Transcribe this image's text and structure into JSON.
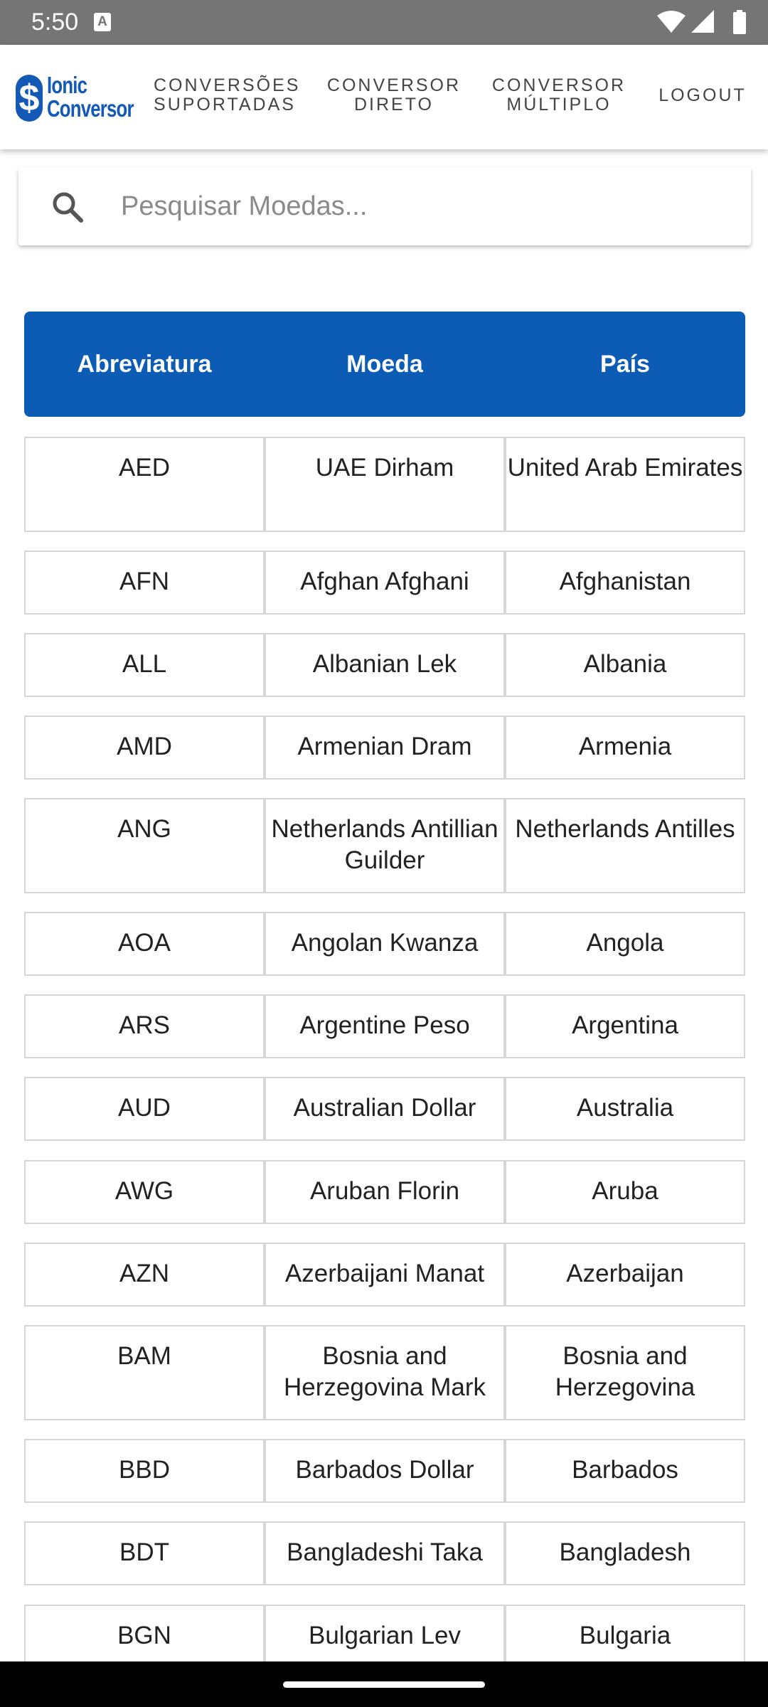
{
  "status": {
    "time": "5:50",
    "notif_letter": "A"
  },
  "logo": {
    "symbol": "$",
    "line1": "Ionic",
    "line2": "Conversor"
  },
  "nav": [
    {
      "line1": "CONVERSÕES",
      "line2": "SUPORTADAS"
    },
    {
      "line1": "CONVERSOR",
      "line2": "DIRETO"
    },
    {
      "line1": "CONVERSOR",
      "line2": "MÚLTIPLO"
    },
    {
      "line1": "LOGOUT",
      "line2": ""
    }
  ],
  "search": {
    "placeholder": "Pesquisar Moedas...",
    "value": ""
  },
  "table": {
    "headers": [
      "Abreviatura",
      "Moeda",
      "País"
    ],
    "rows": [
      {
        "abbr": "AED",
        "currency": "UAE Dirham",
        "country": "United Arab Emirates"
      },
      {
        "abbr": "AFN",
        "currency": "Afghan Afghani",
        "country": "Afghanistan"
      },
      {
        "abbr": "ALL",
        "currency": "Albanian Lek",
        "country": "Albania"
      },
      {
        "abbr": "AMD",
        "currency": "Armenian Dram",
        "country": "Armenia"
      },
      {
        "abbr": "ANG",
        "currency": "Netherlands Antillian Guilder",
        "country": "Netherlands Antilles"
      },
      {
        "abbr": "AOA",
        "currency": "Angolan Kwanza",
        "country": "Angola"
      },
      {
        "abbr": "ARS",
        "currency": "Argentine Peso",
        "country": "Argentina"
      },
      {
        "abbr": "AUD",
        "currency": "Australian Dollar",
        "country": "Australia"
      },
      {
        "abbr": "AWG",
        "currency": "Aruban Florin",
        "country": "Aruba"
      },
      {
        "abbr": "AZN",
        "currency": "Azerbaijani Manat",
        "country": "Azerbaijan"
      },
      {
        "abbr": "BAM",
        "currency": "Bosnia and Herzegovina Mark",
        "country": "Bosnia and Herzegovina"
      },
      {
        "abbr": "BBD",
        "currency": "Barbados Dollar",
        "country": "Barbados"
      },
      {
        "abbr": "BDT",
        "currency": "Bangladeshi Taka",
        "country": "Bangladesh"
      },
      {
        "abbr": "BGN",
        "currency": "Bulgarian Lev",
        "country": "Bulgaria"
      }
    ]
  },
  "colors": {
    "primary": "#0c5bb5",
    "status_bar": "#757575",
    "border": "#d6d6d6"
  }
}
